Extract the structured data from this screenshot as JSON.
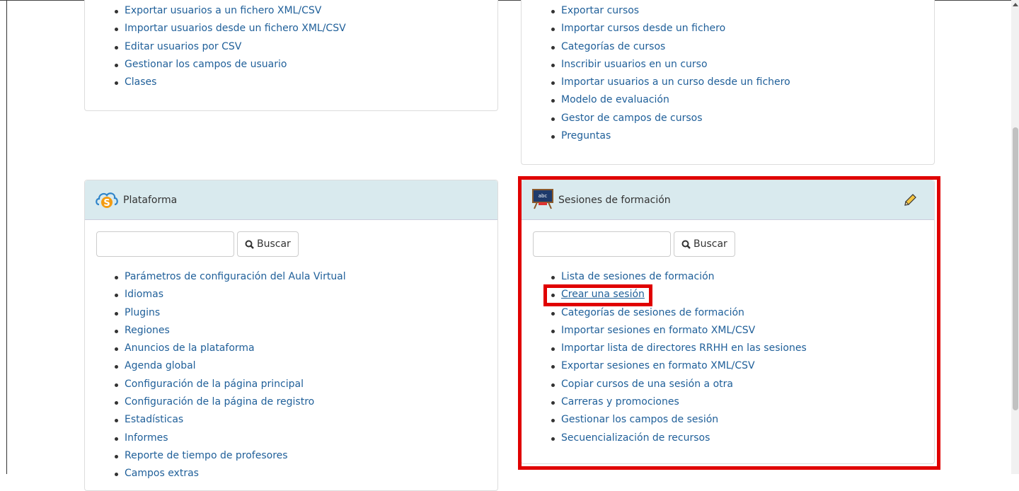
{
  "colors": {
    "link": "#1f5f99",
    "panel_header": "#d9eaee",
    "highlight": "#e00000"
  },
  "users_panel": {
    "links": [
      "Exportar usuarios a un fichero XML/CSV",
      "Importar usuarios desde un fichero XML/CSV",
      "Editar usuarios por CSV",
      "Gestionar los campos de usuario",
      "Clases"
    ]
  },
  "courses_panel": {
    "links": [
      "Exportar cursos",
      "Importar cursos desde un fichero",
      "Categorías de cursos",
      "Inscribir usuarios en un curso",
      "Importar usuarios a un curso desde un fichero",
      "Modelo de evaluación",
      "Gestor de campos de cursos",
      "Preguntas"
    ]
  },
  "platform_panel": {
    "title": "Plataforma",
    "icon": "cloud-s-icon",
    "search": {
      "button_label": "Buscar",
      "value": ""
    },
    "links": [
      "Parámetros de configuración del Aula Virtual",
      "Idiomas",
      "Plugins",
      "Regiones",
      "Anuncios de la plataforma",
      "Agenda global",
      "Configuración de la página principal",
      "Configuración de la página de registro",
      "Estadísticas",
      "Informes",
      "Reporte de tiempo de profesores",
      "Campos extras"
    ]
  },
  "sessions_panel": {
    "title": "Sesiones de formación",
    "icon": "blackboard-icon",
    "edit_icon": "pencil-icon",
    "search": {
      "button_label": "Buscar",
      "value": ""
    },
    "links": [
      "Lista de sesiones de formación",
      "Crear una sesión",
      "Categorías de sesiones de formación",
      "Importar sesiones en formato XML/CSV",
      "Importar lista de directores RRHH en las sesiones",
      "Exportar sesiones en formato XML/CSV",
      "Copiar cursos de una sesión a otra",
      "Carreras y promociones",
      "Gestionar los campos de sesión",
      "Secuencialización de recursos"
    ]
  }
}
